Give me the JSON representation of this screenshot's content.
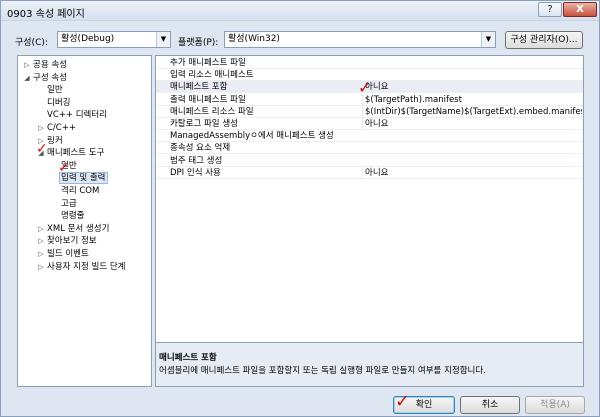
{
  "window": {
    "title": "0903 속성 페이지",
    "help_label": "?",
    "close_label": "X"
  },
  "toolbar": {
    "config_label": "구성(C):",
    "config_value": "활성(Debug)",
    "platform_label": "플랫폼(P):",
    "platform_value": "활성(Win32)",
    "config_manager_label": "구성 관리자(O)..."
  },
  "tree": [
    {
      "label": "공용 속성",
      "exp": "▷",
      "depth": 0
    },
    {
      "label": "구성 속성",
      "exp": "◢",
      "depth": 0
    },
    {
      "label": "일반",
      "exp": "",
      "depth": 1
    },
    {
      "label": "디버깅",
      "exp": "",
      "depth": 1
    },
    {
      "label": "VC++ 디렉터리",
      "exp": "",
      "depth": 1
    },
    {
      "label": "C/C++",
      "exp": "▷",
      "depth": 1
    },
    {
      "label": "링커",
      "exp": "▷",
      "depth": 1
    },
    {
      "label": "매니페스트 도구",
      "exp": "◢",
      "depth": 1
    },
    {
      "label": "일반",
      "exp": "",
      "depth": 2
    },
    {
      "label": "입력 및 출력",
      "exp": "",
      "depth": 2
    },
    {
      "label": "격리 COM",
      "exp": "",
      "depth": 2
    },
    {
      "label": "고급",
      "exp": "",
      "depth": 2
    },
    {
      "label": "명령줄",
      "exp": "",
      "depth": 2
    },
    {
      "label": "XML 문서 생성기",
      "exp": "▷",
      "depth": 1
    },
    {
      "label": "찾아보기 정보",
      "exp": "▷",
      "depth": 1
    },
    {
      "label": "빌드 이벤트",
      "exp": "▷",
      "depth": 1
    },
    {
      "label": "사용자 지정 빌드 단계",
      "exp": "▷",
      "depth": 1
    }
  ],
  "properties": [
    {
      "name": "추가 매니페스트 파일",
      "value": ""
    },
    {
      "name": "입력 리소스 매니페스트",
      "value": ""
    },
    {
      "name": "매니페스트 포함",
      "value": "아니요"
    },
    {
      "name": "출력 매니페스트 파일",
      "value": "$(TargetPath).manifest"
    },
    {
      "name": "매니페스트 리소스 파일",
      "value": "$(IntDir)$(TargetName)$(TargetExt).embed.manifest.res"
    },
    {
      "name": "카탈로그 파일 생성",
      "value": "아니요"
    },
    {
      "name": "ManagedAssemblyㅇ에서 매니페스트 생성",
      "value": ""
    },
    {
      "name": "종속성 요소 억제",
      "value": ""
    },
    {
      "name": "범주 태그 생성",
      "value": ""
    },
    {
      "name": "DPI 인식 사용",
      "value": "아니요"
    }
  ],
  "description": {
    "title": "매니페스트 포함",
    "text": "어셈블리에 매니페스트 파일을 포함할지 또는 독립 실행형 파일로 만들지 여부를 지정합니다."
  },
  "buttons": {
    "ok": "확인",
    "cancel": "취소",
    "apply": "적용(A)"
  },
  "annotation": {
    "mark": "✓",
    "color": "#d01010"
  }
}
